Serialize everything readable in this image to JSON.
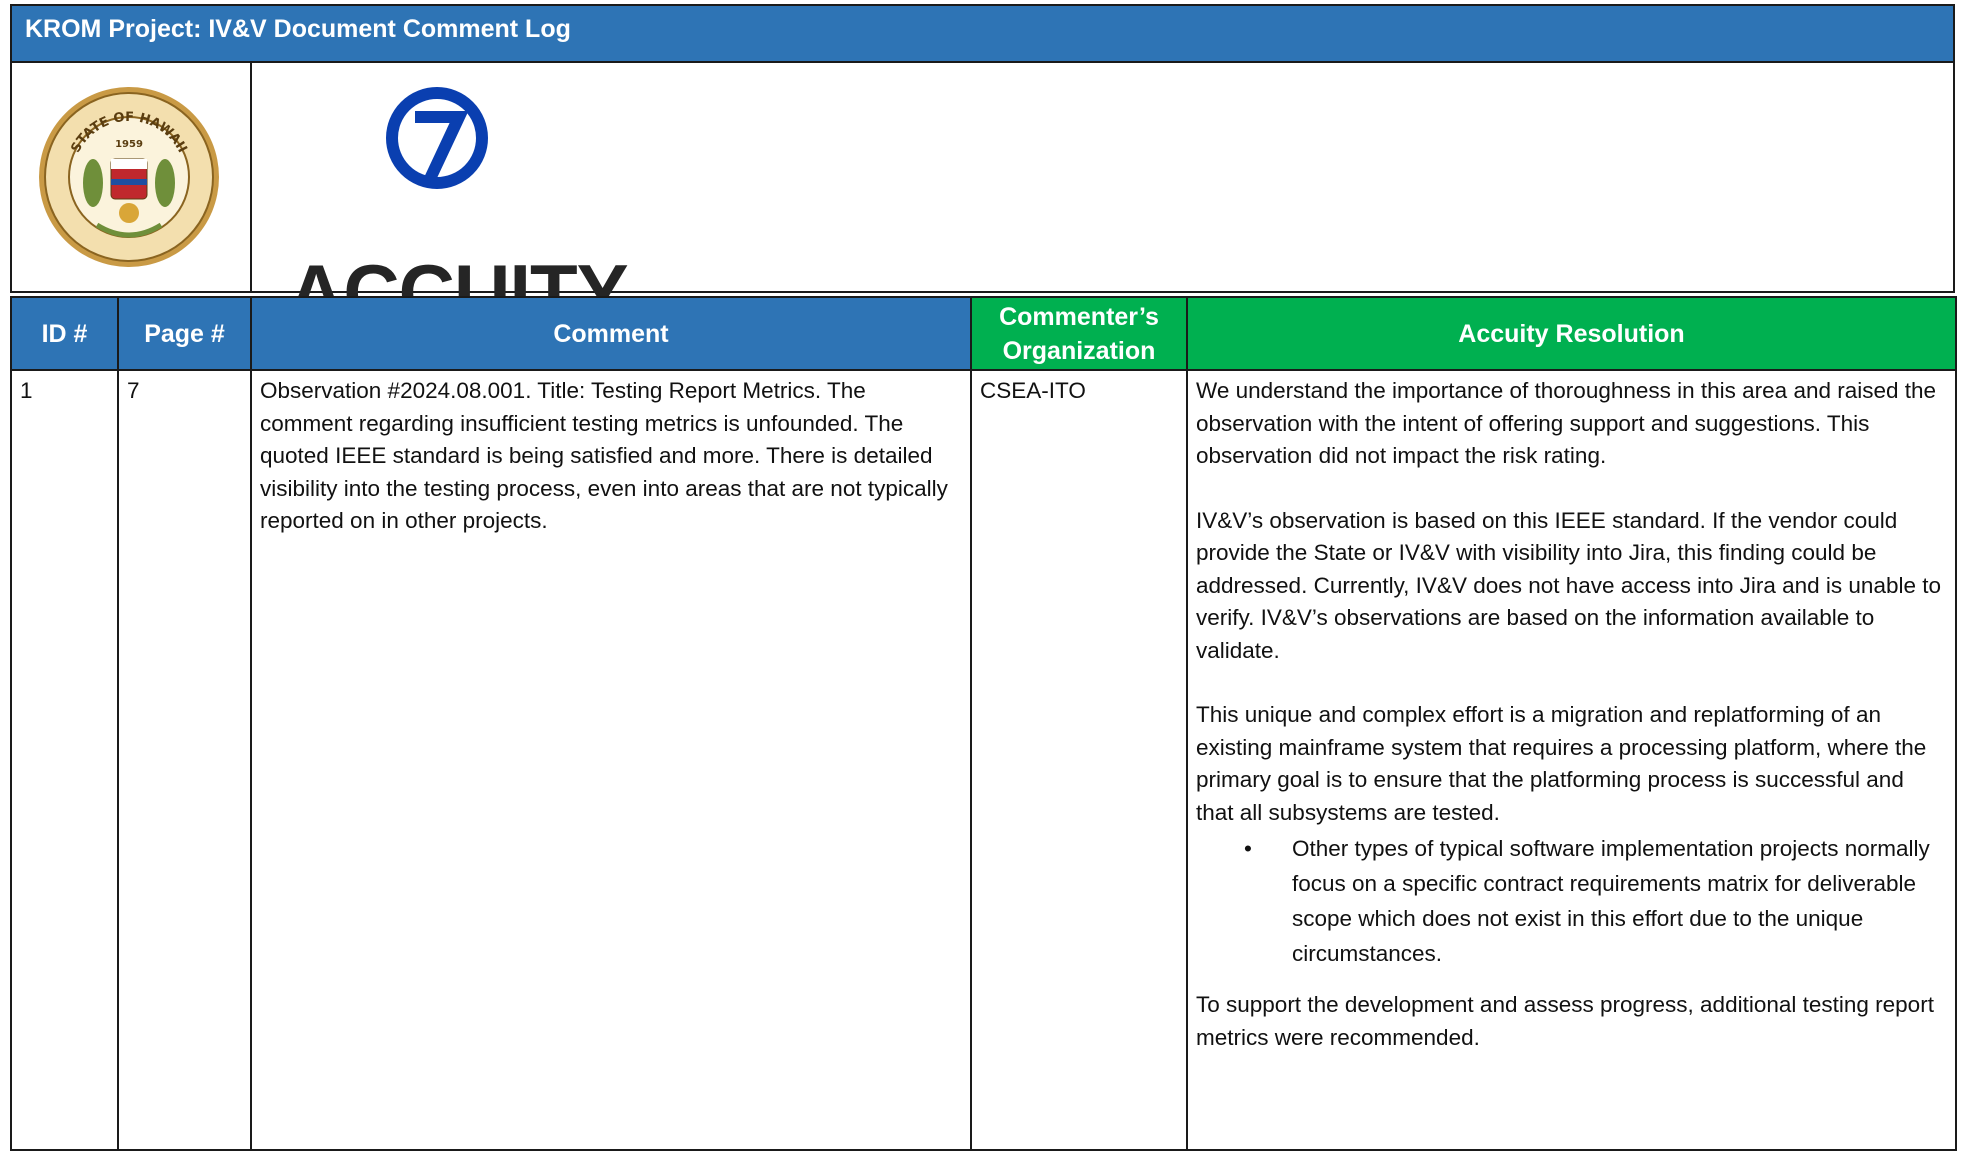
{
  "document": {
    "title": "KROM Project:  IV&V Document Comment Log"
  },
  "logos": {
    "seal_text": "STATE OF HAWAII",
    "seal_year": "1959",
    "brand": "ACCUITY"
  },
  "table": {
    "headers": {
      "id": "ID #",
      "page": "Page #",
      "comment": "Comment",
      "org_line1": "Commenter’s",
      "org_line2": "Organization",
      "resolution": "Accuity Resolution"
    },
    "rows": [
      {
        "id": "1",
        "page": "7",
        "comment": "Observation #2024.08.001.  Title: Testing Report Metrics.  The comment regarding insufficient testing metrics is unfounded.  The quoted IEEE standard is being satisfied and more.  There is detailed visibility into the testing process, even into areas that are not typically reported on in other projects.",
        "organization": "CSEA-ITO",
        "resolution": {
          "p1": "We understand the importance of thoroughness in this area and raised the observation with the intent of offering support and suggestions.  This observation did not impact the risk rating.",
          "p2": "IV&V’s observation is based on this IEEE standard.  If the vendor could provide the State or IV&V with visibility into Jira, this finding could be addressed. Currently, IV&V does not have access into Jira and is unable to verify. IV&V’s observations are based on the information available to validate.",
          "p3": "This unique and complex effort is a migration and replatforming of an existing mainframe system that requires a processing platform, where the primary goal is to ensure that the platforming process is successful and that all subsystems are tested.",
          "bullet1": "Other types of typical software implementation projects normally focus on a specific contract requirements matrix for deliverable scope which does not exist in this effort due to the unique circumstances.",
          "p4": "To support the development and assess progress, additional testing report metrics were recommended."
        }
      }
    ]
  },
  "colors": {
    "header_blue": "#2e74b5",
    "header_green": "#00b050",
    "accuity_blue": "#0a3fb0"
  }
}
